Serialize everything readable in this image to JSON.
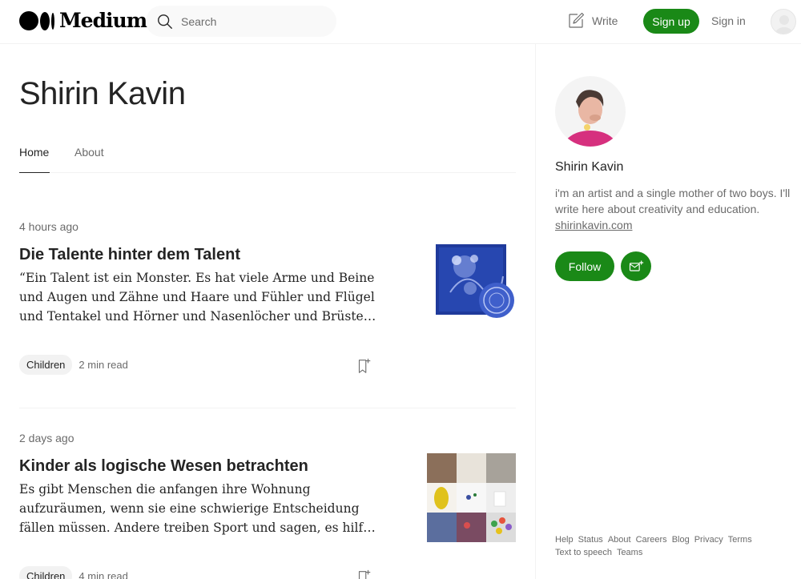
{
  "header": {
    "brand": "Medium",
    "search_placeholder": "Search",
    "write_label": "Write",
    "signup_label": "Sign up",
    "signin_label": "Sign in"
  },
  "profile": {
    "name": "Shirin Kavin",
    "tabs": [
      {
        "label": "Home",
        "active": true
      },
      {
        "label": "About",
        "active": false
      }
    ]
  },
  "articles": [
    {
      "time": "4 hours ago",
      "title": "Die Talente hinter dem Talent",
      "excerpt": "“Ein Talent ist ein Monster. Es hat viele Arme und Beine und Augen und Zähne und Haare und Fühler und Flügel und Tentakel und Hörner und Nasenlöcher und Brüste und Backen…",
      "tag": "Children",
      "read_time": "2 min read"
    },
    {
      "time": "2 days ago",
      "title": "Kinder als logische Wesen betrachten",
      "excerpt": "Es gibt Menschen die anfangen ihre Wohnung aufzuräumen, wenn sie eine schwierige Entscheidung fällen müssen. Andere treiben Sport und sagen, es hilft ihnen dabei, sich über ihre…",
      "tag": "Children",
      "read_time": "4 min read"
    }
  ],
  "sidebar": {
    "name": "Shirin Kavin",
    "bio": "i'm an artist and a single mother of two boys. I'll write here about creativity and education.",
    "link": "shirinkavin.com",
    "follow_label": "Follow",
    "footer_links": [
      "Help",
      "Status",
      "About",
      "Careers",
      "Blog",
      "Privacy",
      "Terms",
      "Text to speech",
      "Teams"
    ]
  },
  "colors": {
    "accent": "#1a8917",
    "text": "#242424",
    "muted": "#6b6b6b",
    "border": "#f2f2f2"
  }
}
